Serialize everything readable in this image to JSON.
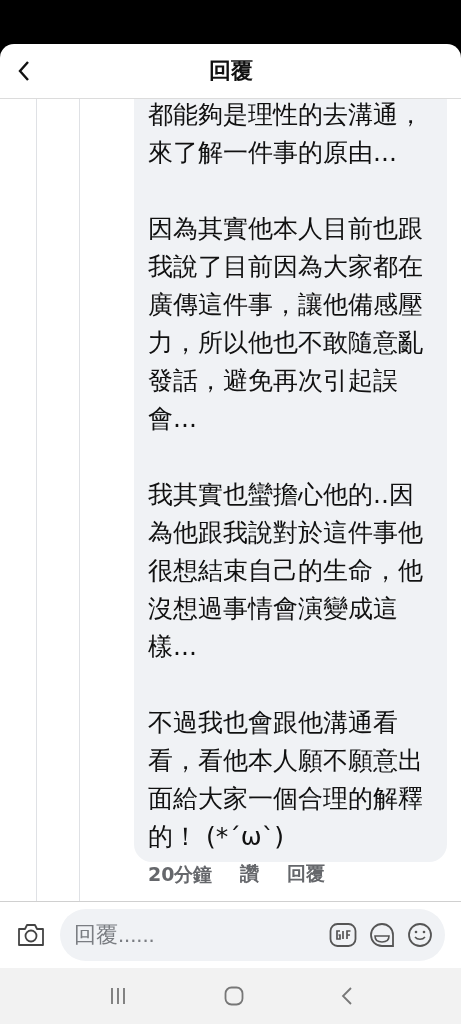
{
  "header": {
    "title": "回覆"
  },
  "comment": {
    "paragraphs": [
      "都能夠是理性的去溝通，來了解一件事的原由...",
      "因為其實他本人目前也跟我說了目前因為大家都在廣傳這件事，讓他備感壓力，所以他也不敢隨意亂發話，避免再次引起誤會...",
      "我其實也蠻擔心他的..因為他跟我說對於這件事他很想結束自己的生命，他沒想過事情會演變成這樣...",
      "不過我也會跟他溝通看看，看他本人願不願意出面給大家一個合理的解釋的！ (*´ω`)"
    ],
    "time": "20分鐘",
    "like": "讚",
    "reply": "回覆"
  },
  "composer": {
    "placeholder": "回覆......"
  }
}
